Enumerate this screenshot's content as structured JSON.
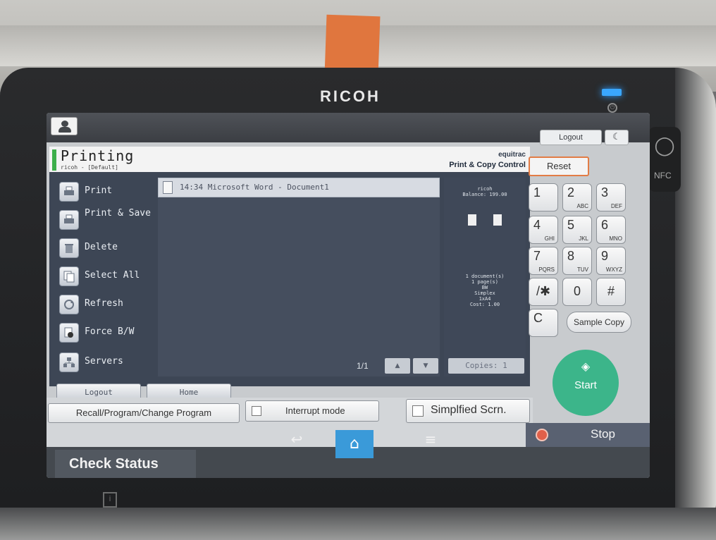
{
  "device": {
    "brand": "RICOH",
    "nfc_label": "NFC"
  },
  "topbar": {
    "logout_label": "Logout",
    "moon_symbol": "☾"
  },
  "app": {
    "title": "Printing",
    "subtitle": "ricoh - [Default]",
    "vendor_brand": "equitrac",
    "vendor_product": "Print & Copy Control"
  },
  "sidebar": {
    "items": [
      {
        "label": "Print",
        "icon": "printer-icon"
      },
      {
        "label": "Print & Save",
        "icon": "print-save-icon"
      },
      {
        "label": "Delete",
        "icon": "trash-icon"
      },
      {
        "label": "Select All",
        "icon": "select-all-icon"
      },
      {
        "label": "Refresh",
        "icon": "refresh-icon"
      },
      {
        "label": "Force B/W",
        "icon": "force-bw-icon"
      },
      {
        "label": "Servers",
        "icon": "servers-icon"
      }
    ]
  },
  "documents": {
    "items": [
      {
        "text": "14:34  Microsoft Word - Document1"
      }
    ],
    "page_indicator": "1/1",
    "up_arrow": "▲",
    "down_arrow": "▼"
  },
  "info": {
    "user": "ricoh",
    "balance": "Balance: 199.00",
    "summary": [
      "1 document(s)",
      "1 page(s)",
      "BW",
      "Simplex",
      "1xA4",
      "Cost: 1.00"
    ],
    "copies": "Copies: 1"
  },
  "app_buttons": {
    "logout": "Logout",
    "home": "Home"
  },
  "keypad": {
    "reset": "Reset",
    "keys": [
      {
        "num": "1",
        "letters": ""
      },
      {
        "num": "2",
        "letters": "ABC"
      },
      {
        "num": "3",
        "letters": "DEF"
      },
      {
        "num": "4",
        "letters": "GHI"
      },
      {
        "num": "5",
        "letters": "JKL"
      },
      {
        "num": "6",
        "letters": "MNO"
      },
      {
        "num": "7",
        "letters": "PQRS"
      },
      {
        "num": "8",
        "letters": "TUV"
      },
      {
        "num": "9",
        "letters": "WXYZ"
      },
      {
        "num": "/✱",
        "letters": ""
      },
      {
        "num": "0",
        "letters": ""
      },
      {
        "num": "#",
        "letters": ""
      }
    ],
    "clear": "C",
    "sample_copy": "Sample Copy",
    "start": "Start"
  },
  "lower_controls": {
    "recall": "Recall/Program/Change Program",
    "interrupt": "Interrupt mode",
    "simplified": "Simplfied Scrn.",
    "stop": "Stop"
  },
  "navbar": {
    "check_status": "Check Status",
    "back_symbol": "↩",
    "home_symbol": "⌂",
    "menu_symbol": "≡"
  },
  "colors": {
    "accent_green": "#3cae4a",
    "start_green": "#3cb58a",
    "reset_orange": "#e27c45",
    "home_blue": "#3a9ad9",
    "stop_red": "#e0604a"
  }
}
